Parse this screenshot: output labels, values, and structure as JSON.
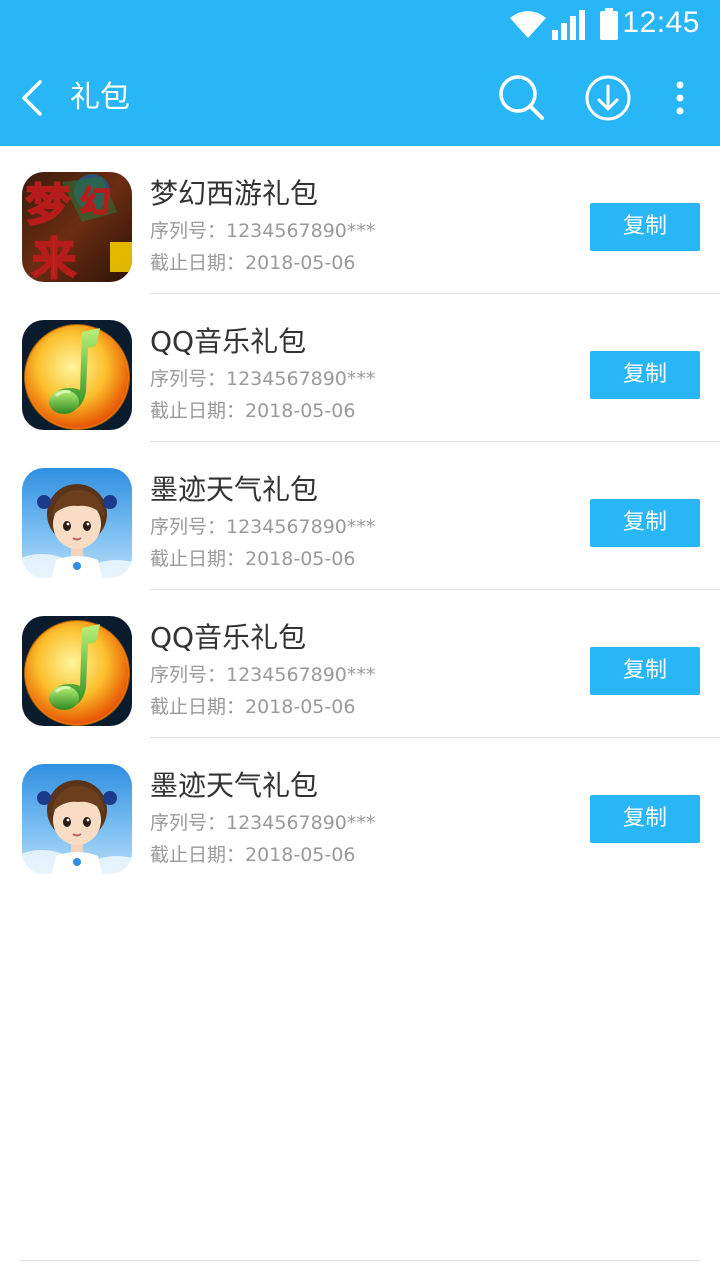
{
  "status_bar": {
    "time": "12:45",
    "icons": [
      "wifi-icon",
      "signal-icon",
      "battery-icon"
    ]
  },
  "toolbar": {
    "title": "礼包",
    "back_icon": "chevron-left-icon",
    "search_icon": "search-icon",
    "download_icon": "download-icon",
    "more_icon": "more-vertical-icon"
  },
  "colors": {
    "accent": "#29b6f6",
    "title_text": "#333333",
    "meta_text": "#9a9a9a",
    "divider": "#dddddd"
  },
  "gifts": [
    {
      "name": "梦幻西游礼包",
      "serial": "序列号：1234567890***",
      "deadline": "截止日期：2018-05-06",
      "button": "复制",
      "icon": "menghuan-xiyou-app-icon"
    },
    {
      "name": "QQ音乐礼包",
      "serial": "序列号：1234567890***",
      "deadline": "截止日期：2018-05-06",
      "button": "复制",
      "icon": "qq-music-app-icon"
    },
    {
      "name": "墨迹天气礼包",
      "serial": "序列号：1234567890***",
      "deadline": "截止日期：2018-05-06",
      "button": "复制",
      "icon": "moji-weather-app-icon"
    },
    {
      "name": "QQ音乐礼包",
      "serial": "序列号：1234567890***",
      "deadline": "截止日期：2018-05-06",
      "button": "复制",
      "icon": "qq-music-app-icon"
    },
    {
      "name": "墨迹天气礼包",
      "serial": "序列号：1234567890***",
      "deadline": "截止日期：2018-05-06",
      "button": "复制",
      "icon": "moji-weather-app-icon"
    }
  ]
}
